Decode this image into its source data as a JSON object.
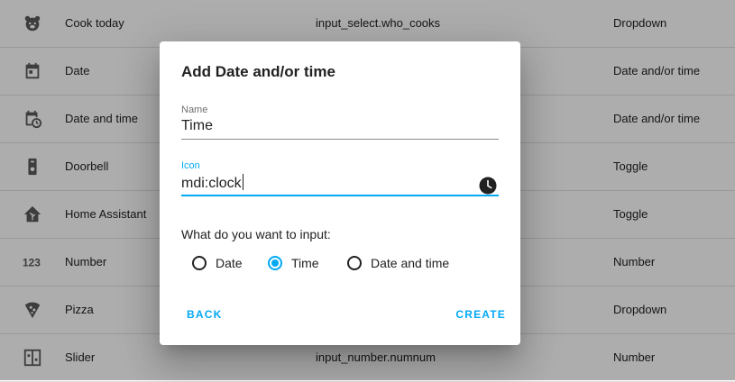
{
  "table": {
    "rows": [
      {
        "icon": "bear-face-icon",
        "name": "Cook today",
        "entity": "input_select.who_cooks",
        "type": "Dropdown"
      },
      {
        "icon": "calendar-icon",
        "name": "Date",
        "entity": "",
        "type": "Date and/or time"
      },
      {
        "icon": "calendar-clock-icon",
        "name": "Date and time",
        "entity": "",
        "type": "Date and/or time"
      },
      {
        "icon": "doorbell-icon",
        "name": "Doorbell",
        "entity": "",
        "type": "Toggle"
      },
      {
        "icon": "home-assistant-icon",
        "name": "Home Assistant",
        "entity": "",
        "type": "Toggle"
      },
      {
        "icon": "numeric-icon",
        "name": "Number",
        "entity": "",
        "type": "Number"
      },
      {
        "icon": "pizza-icon",
        "name": "Pizza",
        "entity": "",
        "type": "Dropdown"
      },
      {
        "icon": "slider-icon",
        "name": "Slider",
        "entity": "input_number.numnum",
        "type": "Number"
      }
    ]
  },
  "dialog": {
    "title": "Add Date and/or time",
    "name_field": {
      "label": "Name",
      "value": "Time"
    },
    "icon_field": {
      "label": "Icon",
      "value": "mdi:clock",
      "icon": "clock-icon"
    },
    "question": "What do you want to input:",
    "options": [
      {
        "label": "Date",
        "checked": false
      },
      {
        "label": "Time",
        "checked": true
      },
      {
        "label": "Date and time",
        "checked": false
      }
    ],
    "back_label": "BACK",
    "create_label": "CREATE"
  },
  "colors": {
    "accent": "#03a9f4",
    "scrim": "rgba(0,0,0,0.32)"
  }
}
